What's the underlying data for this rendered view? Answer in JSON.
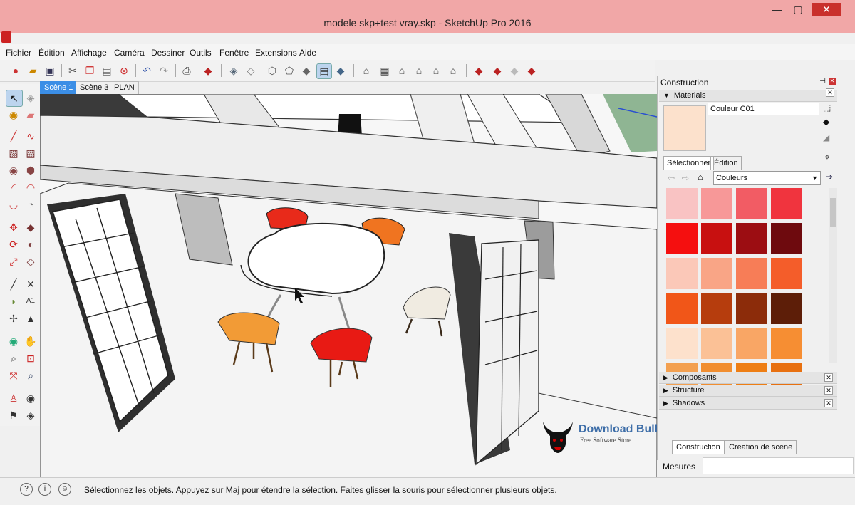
{
  "window": {
    "title": "modele skp+test vray.skp - SketchUp Pro 2016",
    "minimize": "—",
    "maximize": "▢",
    "close": "✕"
  },
  "menu": [
    "Fichier",
    "Édition",
    "Affichage",
    "Caméra",
    "Dessiner",
    "Outils",
    "Fenêtre",
    "Extensions",
    "Aide"
  ],
  "scene_tabs": [
    {
      "label": "Scène 1",
      "active": true
    },
    {
      "label": "Scène 3",
      "active": false
    },
    {
      "label": "PLAN",
      "active": false
    }
  ],
  "status_bar": {
    "message": "Sélectionnez les objets. Appuyez sur Maj pour étendre la sélection. Faites glisser la souris pour sélectionner plusieurs objets.",
    "measures_label": "Mesures"
  },
  "panel": {
    "title": "Construction",
    "materials": {
      "header": "Materials",
      "current_name": "Couleur C01",
      "current_color": "#fce1cc",
      "tab_select": "Sélectionner",
      "tab_edit": "Édition",
      "library": "Couleurs",
      "swatches": [
        [
          "#f9c3c3",
          "#f79898",
          "#f25c64",
          "#f0343e"
        ],
        [
          "#f50f0f",
          "#c81010",
          "#9c0d12",
          "#6e0a0e"
        ],
        [
          "#fbc8b8",
          "#f9a586",
          "#f77d57",
          "#f45d2a"
        ],
        [
          "#f15618",
          "#b63d0d",
          "#8c2c0a",
          "#5d1e08"
        ],
        [
          "#fde1cc",
          "#fbc196",
          "#f9a665",
          "#f68e33"
        ],
        [
          "#f3a050",
          "#f18e30",
          "#ee7e14",
          "#e87010"
        ]
      ]
    },
    "sections": [
      "Composants",
      "Structure",
      "Shadows"
    ],
    "bottom_tabs": [
      "Construction",
      "Creation de scene"
    ]
  },
  "watermark": {
    "title": "Download Bull",
    "subtitle": "Free Software Store"
  }
}
